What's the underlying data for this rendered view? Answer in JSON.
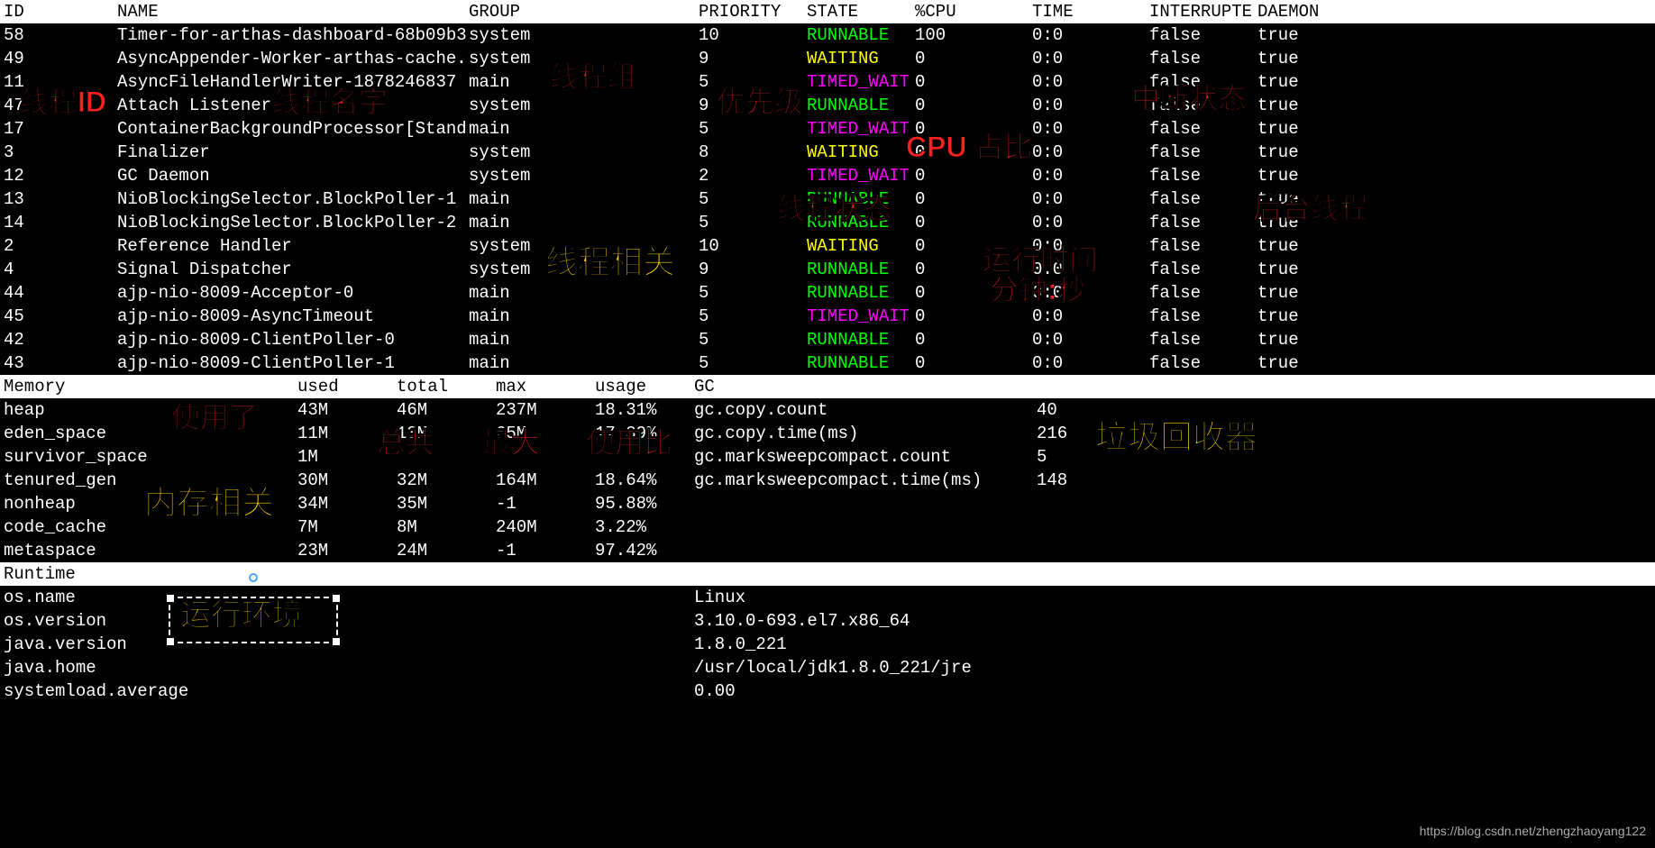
{
  "thread_headers": {
    "id": "ID",
    "name": "NAME",
    "group": "GROUP",
    "priority": "PRIORITY",
    "state": "STATE",
    "cpu": "%CPU",
    "time": "TIME",
    "interrupted": "INTERRUPTE",
    "daemon": "DAEMON"
  },
  "threads": [
    {
      "id": "58",
      "name": "Timer-for-arthas-dashboard-68b09b3",
      "group": "system",
      "priority": "10",
      "state": "RUNNABLE",
      "cpu": "100",
      "time": "0:0",
      "interrupted": "false",
      "daemon": "true"
    },
    {
      "id": "49",
      "name": "AsyncAppender-Worker-arthas-cache.",
      "group": "system",
      "priority": "9",
      "state": "WAITING",
      "cpu": "0",
      "time": "0:0",
      "interrupted": "false",
      "daemon": "true"
    },
    {
      "id": "11",
      "name": "AsyncFileHandlerWriter-1878246837",
      "group": "main",
      "priority": "5",
      "state": "TIMED_WAIT",
      "cpu": "0",
      "time": "0:0",
      "interrupted": "false",
      "daemon": "true"
    },
    {
      "id": "47",
      "name": "Attach Listener",
      "group": "system",
      "priority": "9",
      "state": "RUNNABLE",
      "cpu": "0",
      "time": "0:0",
      "interrupted": "false",
      "daemon": "true"
    },
    {
      "id": "17",
      "name": "ContainerBackgroundProcessor[Stand",
      "group": "main",
      "priority": "5",
      "state": "TIMED_WAIT",
      "cpu": "0",
      "time": "0:0",
      "interrupted": "false",
      "daemon": "true"
    },
    {
      "id": "3",
      "name": "Finalizer",
      "group": "system",
      "priority": "8",
      "state": "WAITING",
      "cpu": "0",
      "time": "0:0",
      "interrupted": "false",
      "daemon": "true"
    },
    {
      "id": "12",
      "name": "GC Daemon",
      "group": "system",
      "priority": "2",
      "state": "TIMED_WAIT",
      "cpu": "0",
      "time": "0:0",
      "interrupted": "false",
      "daemon": "true"
    },
    {
      "id": "13",
      "name": "NioBlockingSelector.BlockPoller-1",
      "group": "main",
      "priority": "5",
      "state": "RUNNABLE",
      "cpu": "0",
      "time": "0:0",
      "interrupted": "false",
      "daemon": "true"
    },
    {
      "id": "14",
      "name": "NioBlockingSelector.BlockPoller-2",
      "group": "main",
      "priority": "5",
      "state": "RUNNABLE",
      "cpu": "0",
      "time": "0:0",
      "interrupted": "false",
      "daemon": "true"
    },
    {
      "id": "2",
      "name": "Reference Handler",
      "group": "system",
      "priority": "10",
      "state": "WAITING",
      "cpu": "0",
      "time": "0:0",
      "interrupted": "false",
      "daemon": "true"
    },
    {
      "id": "4",
      "name": "Signal Dispatcher",
      "group": "system",
      "priority": "9",
      "state": "RUNNABLE",
      "cpu": "0",
      "time": "0:0",
      "interrupted": "false",
      "daemon": "true"
    },
    {
      "id": "44",
      "name": "ajp-nio-8009-Acceptor-0",
      "group": "main",
      "priority": "5",
      "state": "RUNNABLE",
      "cpu": "0",
      "time": "0:0",
      "interrupted": "false",
      "daemon": "true"
    },
    {
      "id": "45",
      "name": "ajp-nio-8009-AsyncTimeout",
      "group": "main",
      "priority": "5",
      "state": "TIMED_WAIT",
      "cpu": "0",
      "time": "0:0",
      "interrupted": "false",
      "daemon": "true"
    },
    {
      "id": "42",
      "name": "ajp-nio-8009-ClientPoller-0",
      "group": "main",
      "priority": "5",
      "state": "RUNNABLE",
      "cpu": "0",
      "time": "0:0",
      "interrupted": "false",
      "daemon": "true"
    },
    {
      "id": "43",
      "name": "ajp-nio-8009-ClientPoller-1",
      "group": "main",
      "priority": "5",
      "state": "RUNNABLE",
      "cpu": "0",
      "time": "0:0",
      "interrupted": "false",
      "daemon": "true"
    }
  ],
  "memory_headers": {
    "section": "Memory",
    "used": "used",
    "total": "total",
    "max": "max",
    "usage": "usage",
    "gc": "GC"
  },
  "memory": [
    {
      "name": "heap",
      "used": "43M",
      "total": "46M",
      "max": "237M",
      "usage": "18.31%",
      "gc": "gc.copy.count",
      "gcval": "40"
    },
    {
      "name": "eden_space",
      "used": "11M",
      "total": "13M",
      "max": "65M",
      "usage": "17.39%",
      "gc": "gc.copy.time(ms)",
      "gcval": "216"
    },
    {
      "name": "survivor_space",
      "used": "1M",
      "total": "",
      "max": "",
      "usage": "",
      "gc": "gc.marksweepcompact.count",
      "gcval": "5"
    },
    {
      "name": "tenured_gen",
      "used": "30M",
      "total": "32M",
      "max": "164M",
      "usage": "18.64%",
      "gc": "gc.marksweepcompact.time(ms)",
      "gcval": "148"
    },
    {
      "name": "nonheap",
      "used": "34M",
      "total": "35M",
      "max": "-1",
      "usage": "95.88%",
      "gc": "",
      "gcval": ""
    },
    {
      "name": "code_cache",
      "used": "7M",
      "total": "8M",
      "max": "240M",
      "usage": "3.22%",
      "gc": "",
      "gcval": ""
    },
    {
      "name": "metaspace",
      "used": "23M",
      "total": "24M",
      "max": "-1",
      "usage": "97.42%",
      "gc": "",
      "gcval": ""
    }
  ],
  "runtime_header": "Runtime",
  "runtime": [
    {
      "key": "os.name",
      "val": "Linux"
    },
    {
      "key": "os.version",
      "val": "3.10.0-693.el7.x86_64"
    },
    {
      "key": "java.version",
      "val": "1.8.0_221"
    },
    {
      "key": "java.home",
      "val": "/usr/local/jdk1.8.0_221/jre"
    },
    {
      "key": "systemload.average",
      "val": "0.00"
    }
  ],
  "annotations": {
    "thread_id": "线程ID",
    "thread_name": "线程名字",
    "thread_group": "线程组",
    "priority": "优先级",
    "thread_state": "线程状态",
    "cpu_pct": "CPU 占比",
    "interrupt_state": "中断状态",
    "daemon_thread": "后台线程",
    "run_time_1": "运行时间",
    "run_time_2": "分钟:秒",
    "thread_related": "线程相关",
    "used": "使用了",
    "total": "总共",
    "max": "最大",
    "usage": "使用比",
    "memory_related": "内存相关",
    "gc": "垃圾回收器",
    "runtime_env": "运行环境"
  },
  "watermark": "https://blog.csdn.net/zhengzhaoyang122"
}
